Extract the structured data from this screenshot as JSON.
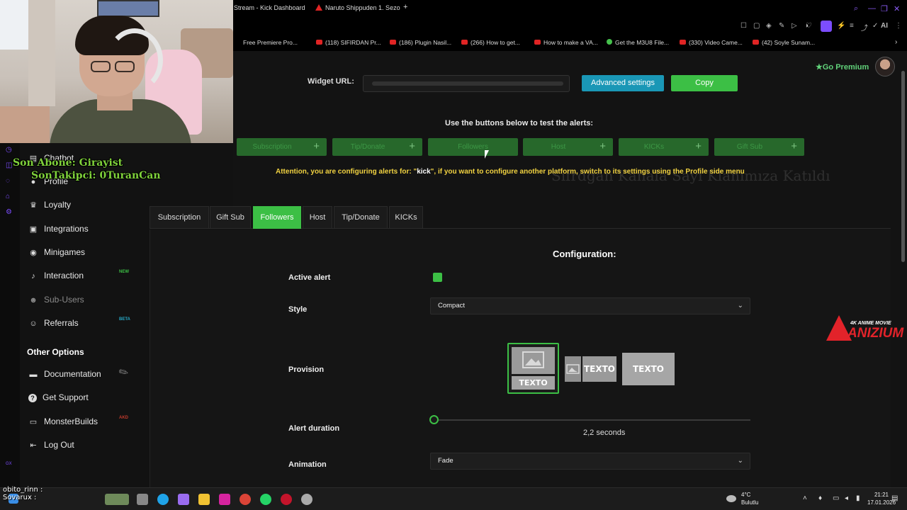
{
  "browser": {
    "tabs": [
      "Stream - Kick Dashboard",
      "Naruto Shippuden 1. Sezo"
    ],
    "new_tab": "+",
    "window_controls": [
      "⌕",
      "—",
      "❐",
      "✕"
    ],
    "toolbar_icons": [
      "☐",
      "▢",
      "◈",
      "✎",
      "▷",
      "◑",
      "♡",
      "⚡",
      "≡",
      "⤴",
      "✓",
      "AI",
      "⋮"
    ]
  },
  "bookmarks": [
    "Free Premiere Pro...",
    "(118) SIFIRDAN Pr...",
    "(186) Plugin Nasil...",
    "(266) How to get...",
    "How to make a VA...",
    "Get the M3U8 File...",
    "(330) Video Came...",
    "(42) Soyle Sunam..."
  ],
  "overlay": {
    "line1": "Son Abone: Girayist",
    "line2": "SonTakipci: 0TuranCan",
    "ghost": "Sifrdgan Kanala Sayı Klanımıza Katıldı"
  },
  "sidebar": {
    "items": [
      {
        "label": "Chatbot",
        "icon": "robot-icon",
        "glyph": "▤"
      },
      {
        "label": "Profile",
        "icon": "user-icon",
        "glyph": "●"
      },
      {
        "label": "Loyalty",
        "icon": "trophy-icon",
        "glyph": "♛"
      },
      {
        "label": "Integrations",
        "icon": "integrations-icon",
        "glyph": "▣"
      },
      {
        "label": "Minigames",
        "icon": "gamepad-icon",
        "glyph": "◉"
      },
      {
        "label": "Interaction",
        "icon": "music-icon",
        "glyph": "♪",
        "badge": "NEW"
      },
      {
        "label": "Sub-Users",
        "icon": "users-icon",
        "glyph": "☻"
      },
      {
        "label": "Referrals",
        "icon": "referrals-icon",
        "glyph": "☺",
        "badge": "BETA"
      }
    ],
    "other_title": "Other Options",
    "other_items": [
      {
        "label": "Documentation",
        "icon": "document-icon",
        "glyph": "▬"
      },
      {
        "label": "Get Support",
        "icon": "help-icon",
        "glyph": "?"
      },
      {
        "label": "MonsterBuilds",
        "icon": "laptop-icon",
        "glyph": "▭",
        "badge": "AKD"
      },
      {
        "label": "Log Out",
        "icon": "logout-icon",
        "glyph": "⇤"
      }
    ],
    "badge_colors": {
      "NEW": "#3cbf45",
      "BETA": "#27a9c7",
      "AKD": "#c0392b"
    }
  },
  "header": {
    "widget_url_label": "Widget URL:",
    "advanced_settings": "Advanced settings",
    "copy": "Copy",
    "go_premium": "Go Premium"
  },
  "test": {
    "title": "Use the buttons below to test the alerts:",
    "buttons": [
      "Subscription",
      "Tip/Donate",
      "Followers",
      "Host",
      "KICKs",
      "Gift Sub"
    ],
    "plus": "+"
  },
  "attention": {
    "prefix": "Attention, you are configuring alerts for: \"",
    "platform": "kick",
    "suffix": "\", if you want to configure another platform, switch to its settings using the Profile side menu"
  },
  "tabs": [
    {
      "label": "Subscription",
      "active": false
    },
    {
      "label": "Gift Sub",
      "active": false
    },
    {
      "label": "Followers",
      "active": true
    },
    {
      "label": "Host",
      "active": false
    },
    {
      "label": "Tip/Donate",
      "active": false
    },
    {
      "label": "KICKs",
      "active": false
    }
  ],
  "config": {
    "title": "Configuration:",
    "active_alert_label": "Active alert",
    "active_alert_checked": true,
    "style_label": "Style",
    "style_value": "Compact",
    "provision_label": "Provision",
    "provision_text": "TEXTO",
    "provision_selected": 0,
    "duration_label": "Alert duration",
    "duration_value": "2,2 seconds",
    "duration_fraction": 0.0,
    "animation_label": "Animation",
    "animation_value": "Fade"
  },
  "watermark": {
    "small": "4K ANIME MOVIE",
    "big": "ANIZIUM"
  },
  "taskbar": {
    "weather_temp": "4°C",
    "weather_desc": "Bulutlu",
    "time": "21:21",
    "date": "17.01.2026",
    "chat_line1": "obito_rinn :",
    "chat_line2": "Sovarux :"
  },
  "colors": {
    "accent": "#3cbf45",
    "info": "#1a97b6",
    "warning": "#f1d241",
    "brand": "#7c4dff"
  }
}
